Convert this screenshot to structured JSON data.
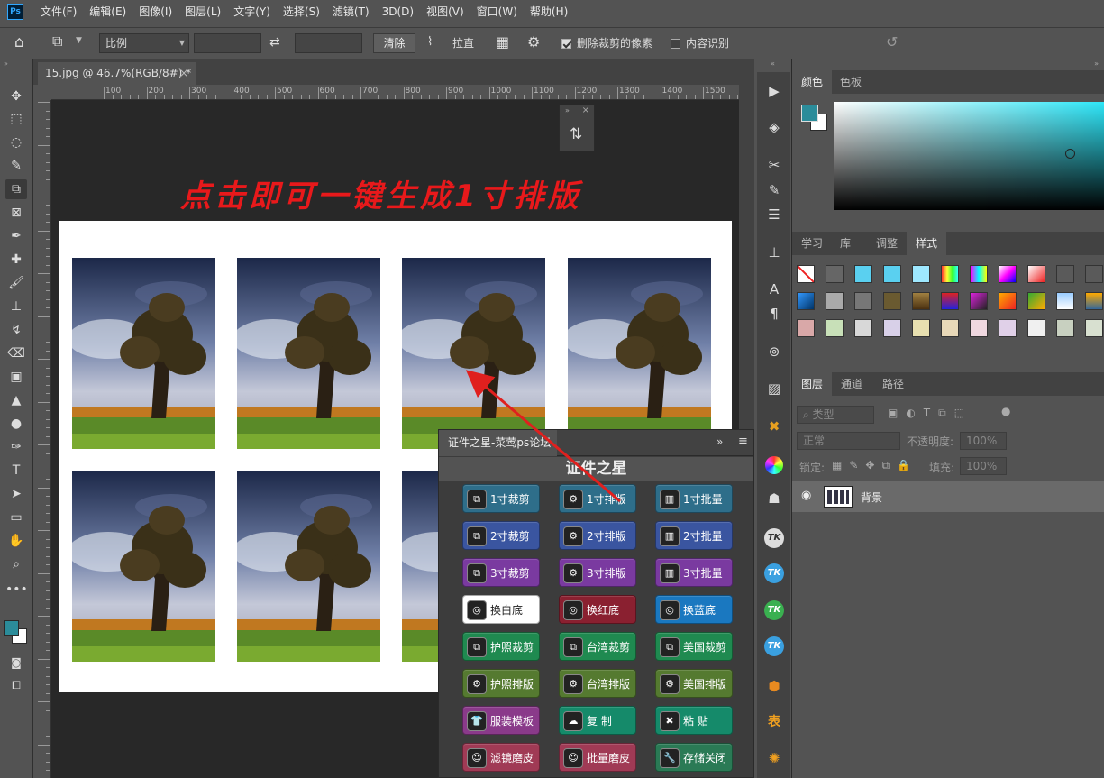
{
  "app": {
    "logo": "Ps"
  },
  "menu": [
    "文件(F)",
    "编辑(E)",
    "图像(I)",
    "图层(L)",
    "文字(Y)",
    "选择(S)",
    "滤镜(T)",
    "3D(D)",
    "视图(V)",
    "窗口(W)",
    "帮助(H)"
  ],
  "options": {
    "ratio": "比例",
    "clear": "清除",
    "straighten": "拉直",
    "delete_cropped": "删除裁剪的像素",
    "content_aware": "内容识别",
    "delete_cropped_checked": true,
    "content_aware_checked": false
  },
  "document": {
    "tab_title": "15.jpg @ 46.7%(RGB/8#) *",
    "close": "×",
    "ruler_labels": [
      "100",
      "200",
      "300",
      "400",
      "500",
      "600",
      "700",
      "800",
      "900",
      "1000",
      "1100",
      "1200",
      "1300",
      "1400",
      "1500",
      "1"
    ],
    "headline": "点击即可一键生成1寸排版"
  },
  "color_panel": {
    "tabs": [
      "颜色",
      "色板"
    ],
    "fg_color": "#2b8c9a",
    "bg_color": "#ffffff"
  },
  "style_panel": {
    "tabs": [
      "学习",
      "库",
      "调整",
      "样式"
    ]
  },
  "layers_panel": {
    "tabs": [
      "图层",
      "通道",
      "路径"
    ],
    "kind_filter": "类型",
    "blend_mode": "正常",
    "opacity_label": "不透明度:",
    "opacity_value": "100%",
    "lock_label": "锁定:",
    "fill_label": "填充:",
    "fill_value": "100%",
    "layer_name": "背景"
  },
  "right_strip": {
    "table_label": "表",
    "tk_label": "TK"
  },
  "plugin": {
    "tab": "证件之星-菜莺ps论坛",
    "title": "证件之星",
    "buttons": [
      [
        {
          "label": "1寸裁剪",
          "color": "#2e6e8a",
          "icon": "crop-icon"
        },
        {
          "label": "1寸排版",
          "color": "#2e6e8a",
          "icon": "gears-icon"
        },
        {
          "label": "1寸批量",
          "color": "#2e6e8a",
          "icon": "chart-icon"
        }
      ],
      [
        {
          "label": "2寸裁剪",
          "color": "#3a55a0",
          "icon": "crop-icon"
        },
        {
          "label": "2寸排版",
          "color": "#3a55a0",
          "icon": "gears-icon"
        },
        {
          "label": "2寸批量",
          "color": "#3a55a0",
          "icon": "chart-icon"
        }
      ],
      [
        {
          "label": "3寸裁剪",
          "color": "#7a3aa0",
          "icon": "crop-icon"
        },
        {
          "label": "3寸排版",
          "color": "#7a3aa0",
          "icon": "gears-icon"
        },
        {
          "label": "3寸批量",
          "color": "#7a3aa0",
          "icon": "chart-icon"
        }
      ],
      [
        {
          "label": "换白底",
          "color": "#ffffff",
          "icon": "film-reel-icon"
        },
        {
          "label": "换红底",
          "color": "#8a2030",
          "icon": "film-reel-icon"
        },
        {
          "label": "换蓝底",
          "color": "#1a78c0",
          "icon": "film-reel-icon"
        }
      ],
      [
        {
          "label": "护照裁剪",
          "color": "#1f8a50",
          "icon": "crop-icon"
        },
        {
          "label": "台湾裁剪",
          "color": "#1f8a50",
          "icon": "crop-icon"
        },
        {
          "label": "美国裁剪",
          "color": "#1f8a50",
          "icon": "crop-icon"
        }
      ],
      [
        {
          "label": "护照排版",
          "color": "#557a30",
          "icon": "gears-icon"
        },
        {
          "label": "台湾排版",
          "color": "#557a30",
          "icon": "gears-icon"
        },
        {
          "label": "美国排版",
          "color": "#557a30",
          "icon": "gears-icon"
        }
      ],
      [
        {
          "label": "服装模板",
          "color": "#8a3a8a",
          "icon": "shirt-icon"
        },
        {
          "label": "复 制",
          "color": "#158a6a",
          "icon": "cloud-icon"
        },
        {
          "label": "粘 贴",
          "color": "#158a6a",
          "icon": "tools-icon"
        }
      ],
      [
        {
          "label": "滤镜磨皮",
          "color": "#a03a55",
          "icon": "person-icon"
        },
        {
          "label": "批量磨皮",
          "color": "#a03a55",
          "icon": "person-icon"
        },
        {
          "label": "存储关闭",
          "color": "#2a7a55",
          "icon": "wrench-icon"
        }
      ]
    ]
  }
}
